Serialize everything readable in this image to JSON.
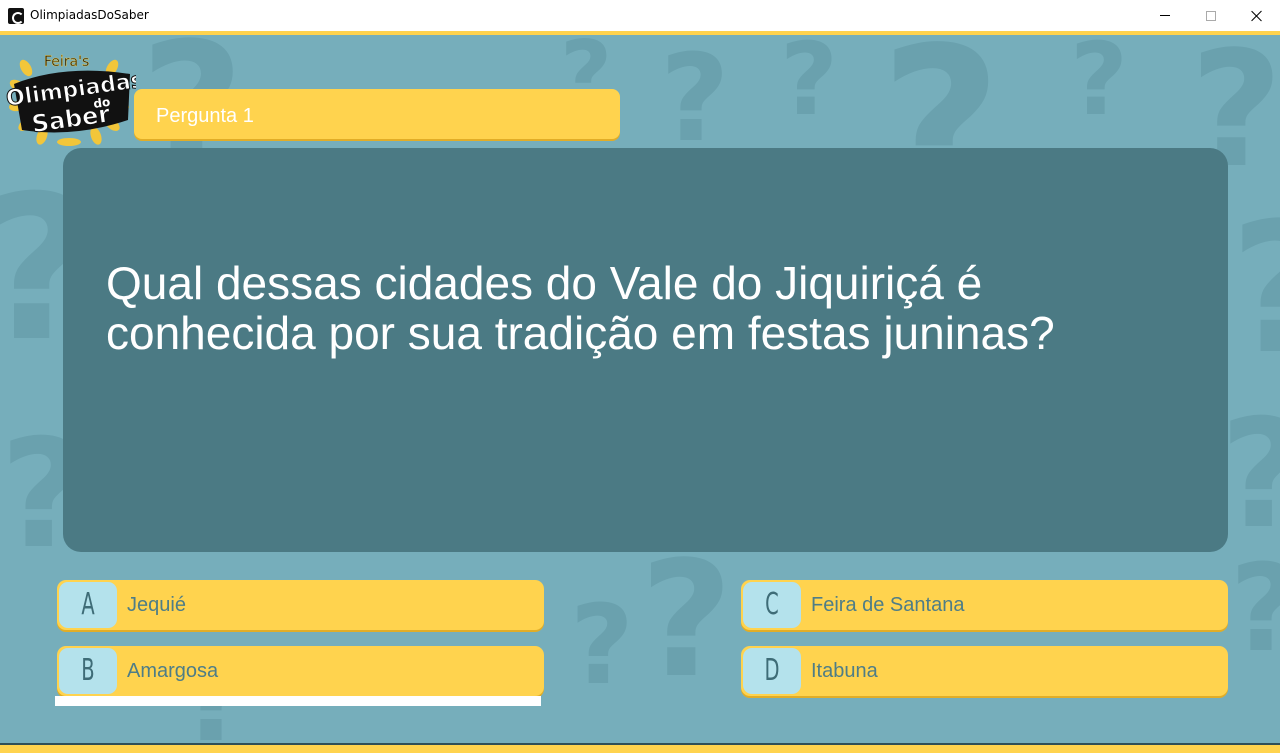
{
  "window": {
    "title": "OlimpiadasDoSaber"
  },
  "logo": {
    "line_top": "Feira's",
    "line_main": "Olimpiadas",
    "line_do": "do",
    "line_saber": "Saber",
    "colors": {
      "laurel": "#f2c63a",
      "badge": "#111111",
      "text": "#ffffff"
    }
  },
  "question": {
    "label": "Pergunta 1",
    "text": "Qual dessas cidades do Vale do Jiquiriçá é conhecida por sua tradição em festas juninas?"
  },
  "options": [
    {
      "letter": "A",
      "text": "Jequié"
    },
    {
      "letter": "B",
      "text": "Amargosa"
    },
    {
      "letter": "C",
      "text": "Feira de Santana"
    },
    {
      "letter": "D",
      "text": "Itabuna"
    }
  ],
  "selected_option": "B",
  "colors": {
    "background": "#76aebb",
    "panel": "#4b7a84",
    "accent_yellow": "#ffd34e",
    "letter_badge": "#b4e2ec",
    "option_text": "#4e7d87"
  }
}
